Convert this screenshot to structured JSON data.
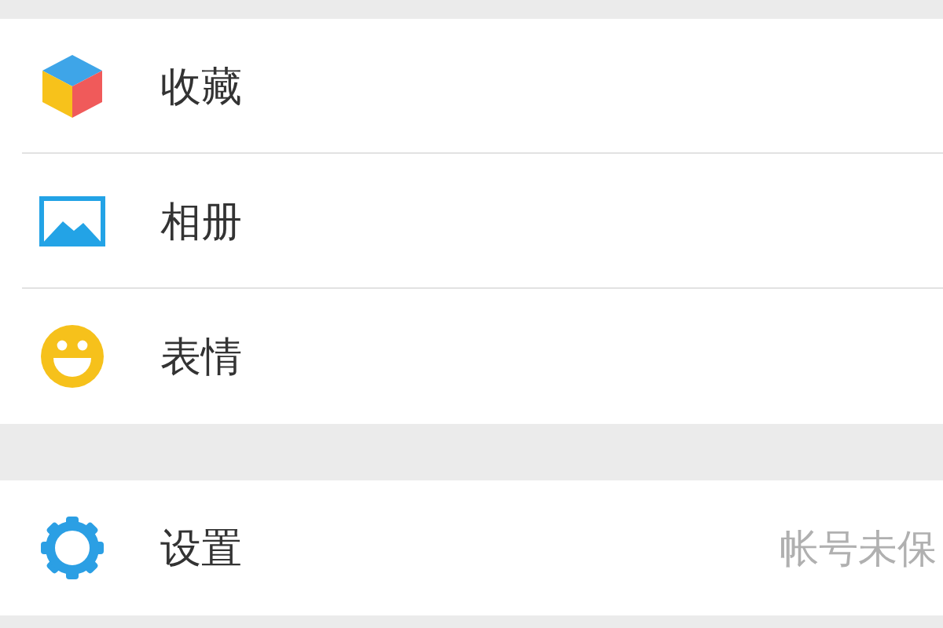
{
  "groups": [
    {
      "items": [
        {
          "label": "收藏"
        },
        {
          "label": "相册"
        },
        {
          "label": "表情"
        }
      ]
    },
    {
      "items": [
        {
          "label": "设置",
          "value": "帐号未保"
        }
      ]
    }
  ]
}
